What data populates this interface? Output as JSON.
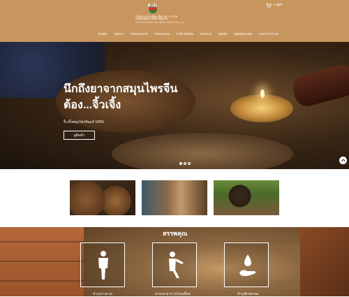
{
  "header": {
    "brand_name": "จิ้วเจิ้ง",
    "company_th": "บริษัท จงโซ่วเฟินเหยี่ยวหลาง จำกัด",
    "company_cn": "中国传统医药 (泰国) 有限公司",
    "company_en": "JONG ZHONGHUANG BEYS GROUP CO.,LTD",
    "login_label": "Login",
    "cart_icon": "cart-icon"
  },
  "nav": {
    "items": [
      "HOME",
      "ABOUT",
      "PRODUCTS",
      "PROCESS",
      "OUR WORK",
      "NOTICE",
      "NEWS",
      "WEBBOARD",
      "CONTACT US"
    ]
  },
  "hero": {
    "title_line1": "นึกถึงยาจากสมุนไพรจีน",
    "title_line2": "ต้อง...จิ้วเจิ้ง",
    "subtitle": "จิ้วเจิ้งสมุนไพรจีนแท้ 100%",
    "button_label": "ดูสินค้า",
    "slide_count": 3,
    "active_slide": 1
  },
  "features": {
    "title": "สรรพคุณ",
    "items": [
      {
        "label": "บำรุงร่างกาย",
        "icon": "human-body-icon"
      },
      {
        "label": "บรรเทาอาการปวดเมื่อย",
        "icon": "massage-icon"
      },
      {
        "label": "บำรุงผิวพรรณ",
        "icon": "hand-drop-icon"
      }
    ]
  }
}
